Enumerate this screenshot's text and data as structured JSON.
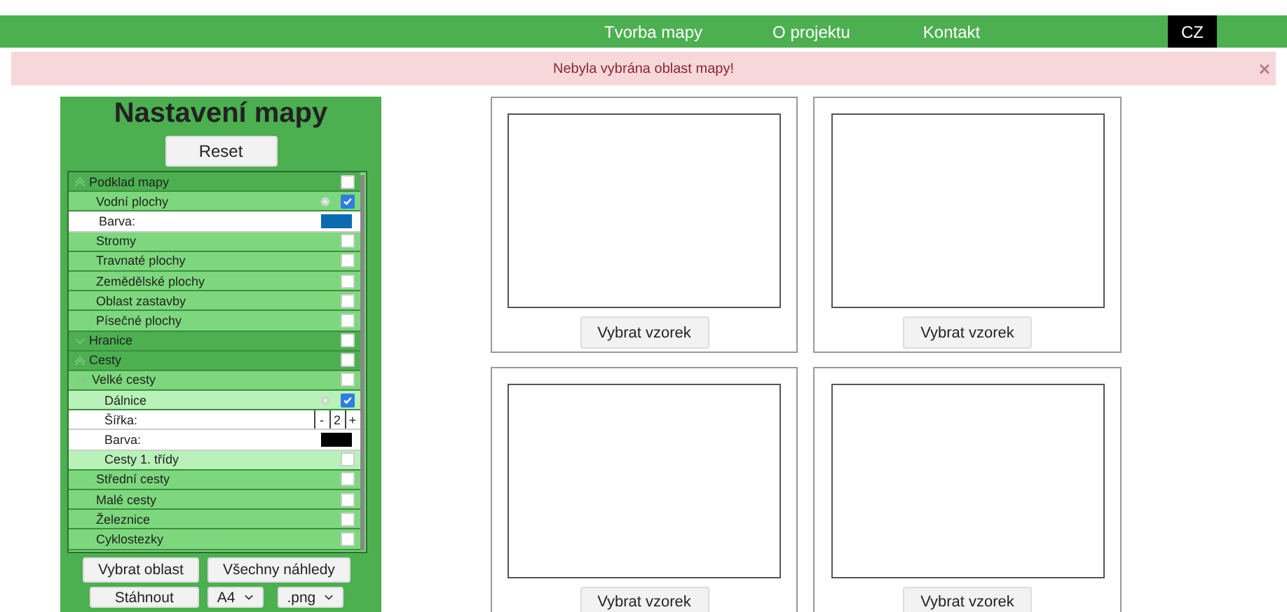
{
  "nav": {
    "links": [
      {
        "label": "Tvorba mapy"
      },
      {
        "label": "O projektu"
      },
      {
        "label": "Kontakt"
      }
    ],
    "language": "CZ"
  },
  "alert": {
    "message": "Nebyla vybrána oblast mapy!",
    "close": "×"
  },
  "sidebar": {
    "title": "Nastavení mapy",
    "reset": "Reset",
    "layers": [
      {
        "label": "Podklad mapy",
        "expanded": true,
        "checked": false,
        "children": [
          {
            "label": "Vodní plochy",
            "checked": true,
            "settings": true,
            "options": [
              {
                "kind": "color",
                "label": "Barva:",
                "color": "#0b6bb0"
              }
            ]
          },
          {
            "label": "Stromy",
            "checked": false
          },
          {
            "label": "Travnaté plochy",
            "checked": false
          },
          {
            "label": "Zemědělské plochy",
            "checked": false
          },
          {
            "label": "Oblast zastavby",
            "checked": false
          },
          {
            "label": "Písečné plochy",
            "checked": false
          }
        ]
      },
      {
        "label": "Hranice",
        "expanded": false,
        "checked": false
      },
      {
        "label": "Cesty",
        "expanded": true,
        "checked": false,
        "children": [
          {
            "label": "Velké cesty",
            "expanded": true,
            "checked": false,
            "children": [
              {
                "label": "Dálnice",
                "checked": true,
                "settings": true,
                "options": [
                  {
                    "kind": "width",
                    "label": "Šířka:",
                    "minus": "-",
                    "value": "2",
                    "plus": "+"
                  },
                  {
                    "kind": "color",
                    "label": "Barva:",
                    "color": "#000000"
                  }
                ]
              },
              {
                "label": "Cesty 1. třídy",
                "checked": false
              }
            ]
          },
          {
            "label": "Střední cesty",
            "checked": false
          },
          {
            "label": "Malé cesty",
            "checked": false
          },
          {
            "label": "Železnice",
            "checked": false
          },
          {
            "label": "Cyklostezky",
            "checked": false
          }
        ]
      }
    ],
    "actions": [
      "Vybrat oblast",
      "Všechny náhledy"
    ],
    "download": "Stáhnout",
    "paper": "A4",
    "format": ".png"
  },
  "samples": [
    {
      "button": "Vybrat vzorek"
    },
    {
      "button": "Vybrat vzorek"
    },
    {
      "button": "Vybrat vzorek"
    },
    {
      "button": "Vybrat vzorek"
    }
  ]
}
